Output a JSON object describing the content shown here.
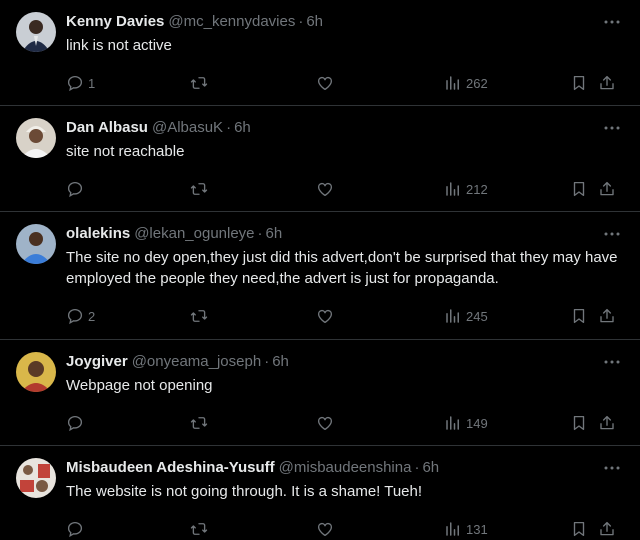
{
  "colors": {
    "background": "#000000",
    "text": "#e7e9ea",
    "muted": "#71767b",
    "divider": "#2f3336"
  },
  "icons": {
    "more": "more-dots-icon",
    "reply": "reply-icon",
    "retweet": "retweet-icon",
    "like": "like-icon",
    "views": "views-icon",
    "bookmark": "bookmark-icon",
    "share": "share-icon"
  },
  "tweets": [
    {
      "name": "Kenny Davies",
      "handle": "@mc_kennydavies",
      "separator": "·",
      "time": "6h",
      "text": "link is not active",
      "replies": "1",
      "retweets": "",
      "likes": "",
      "views": "262"
    },
    {
      "name": "Dan Albasu",
      "handle": "@AlbasuK",
      "separator": "·",
      "time": "6h",
      "text": "site not reachable",
      "replies": "",
      "retweets": "",
      "likes": "",
      "views": "212"
    },
    {
      "name": "olalekins",
      "handle": "@lekan_ogunleye",
      "separator": "·",
      "time": "6h",
      "text": "The site no dey open,they just did this advert,don't be surprised that they may have employed the people they need,the advert is just for propaganda.",
      "replies": "2",
      "retweets": "",
      "likes": "",
      "views": "245"
    },
    {
      "name": "Joygiver",
      "handle": "@onyeama_joseph",
      "separator": "·",
      "time": "6h",
      "text": "Webpage not opening",
      "replies": "",
      "retweets": "",
      "likes": "",
      "views": "149"
    },
    {
      "name": "Misbaudeen Adeshina-Yusuff",
      "handle": "@misbaudeenshina",
      "separator": "·",
      "time": "6h",
      "text": "The website is not going through. It is a shame! Tueh!",
      "replies": "",
      "retweets": "",
      "likes": "",
      "views": "131"
    }
  ]
}
